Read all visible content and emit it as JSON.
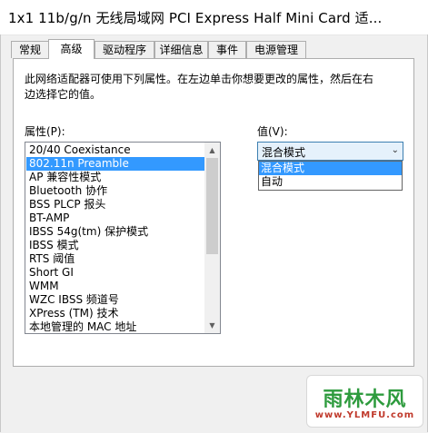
{
  "window": {
    "title": "1x1 11b/g/n 无线局域网 PCI Express Half Mini Card 适..."
  },
  "tabs": [
    {
      "label": "常规"
    },
    {
      "label": "高级"
    },
    {
      "label": "驱动程序"
    },
    {
      "label": "详细信息"
    },
    {
      "label": "事件"
    },
    {
      "label": "电源管理"
    }
  ],
  "active_tab": "高级",
  "panel": {
    "description_line1": "此网络适配器可使用下列属性。在左边单击你想要更改的属性，然后在右",
    "description_line2": "边选择它的值。",
    "property_label": "属性(P):",
    "value_label": "值(V):"
  },
  "properties": {
    "items": [
      "20/40 Coexistance",
      "802.11n Preamble",
      "AP 兼容性模式",
      "Bluetooth 协作",
      "BSS PLCP 报头",
      "BT-AMP",
      "IBSS 54g(tm) 保护模式",
      "IBSS 模式",
      "RTS 阈值",
      "Short GI",
      "WMM",
      "WZC IBSS 频道号",
      "XPress (TM) 技术",
      "本地管理的 MAC 地址"
    ],
    "selected": "802.11n Preamble"
  },
  "value": {
    "current": "混合模式",
    "options": [
      "混合模式",
      "自动"
    ],
    "highlighted": "混合模式"
  },
  "watermark": {
    "brand": "雨林木风",
    "url": "www.YLMFU.com"
  },
  "colors": {
    "selection": "#3399ff",
    "watermark_green": "#2e9b3e",
    "watermark_red": "#c0392b"
  }
}
